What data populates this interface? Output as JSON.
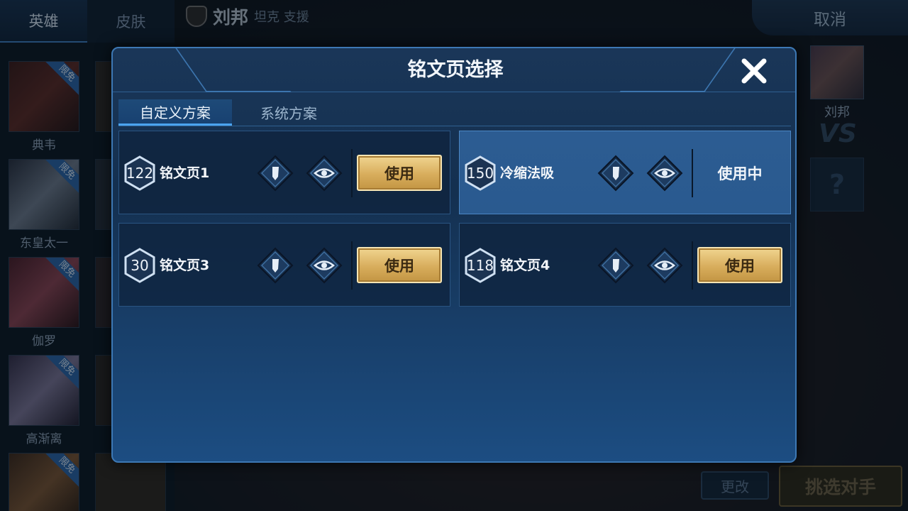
{
  "background": {
    "side_tabs": [
      "英雄",
      "皮肤"
    ],
    "hero_list": [
      {
        "name": "典韦",
        "badge": "限免",
        "tint": "#5b2a25"
      },
      {
        "name": "东皇太一",
        "badge": "限免",
        "tint": "#4a5566"
      },
      {
        "name": "伽罗",
        "badge": "限免",
        "tint": "#7a3a46"
      },
      {
        "name": "高渐离",
        "badge": "限免",
        "tint": "#5d5678"
      },
      {
        "name": "",
        "badge": "限免",
        "tint": "#6a4a30"
      }
    ],
    "top_hero_name": "刘邦",
    "top_hero_role": "坦克 支援",
    "cancel_label": "取消",
    "opponent_name": "刘邦",
    "vs_label": "VS",
    "unknown_label": "?",
    "change_label": "更改",
    "pick_opponent_label": "挑选对手"
  },
  "modal": {
    "title": "铭文页选择",
    "close_icon": "close-icon",
    "tabs": [
      {
        "label": "自定义方案",
        "active": true
      },
      {
        "label": "系统方案",
        "active": false
      }
    ],
    "pages": [
      {
        "level": "122",
        "name": "铭文页1",
        "action": "使用"
      },
      {
        "level": "150",
        "name": "冷缩法吸",
        "action": "使用中"
      },
      {
        "level": "30",
        "name": "铭文页3",
        "action": "使用"
      },
      {
        "level": "118",
        "name": "铭文页4",
        "action": "使用"
      }
    ]
  },
  "colors": {
    "accent": "#4ba4ef",
    "gold_button": "#d8ad5c",
    "modal_bg": "#143050"
  }
}
